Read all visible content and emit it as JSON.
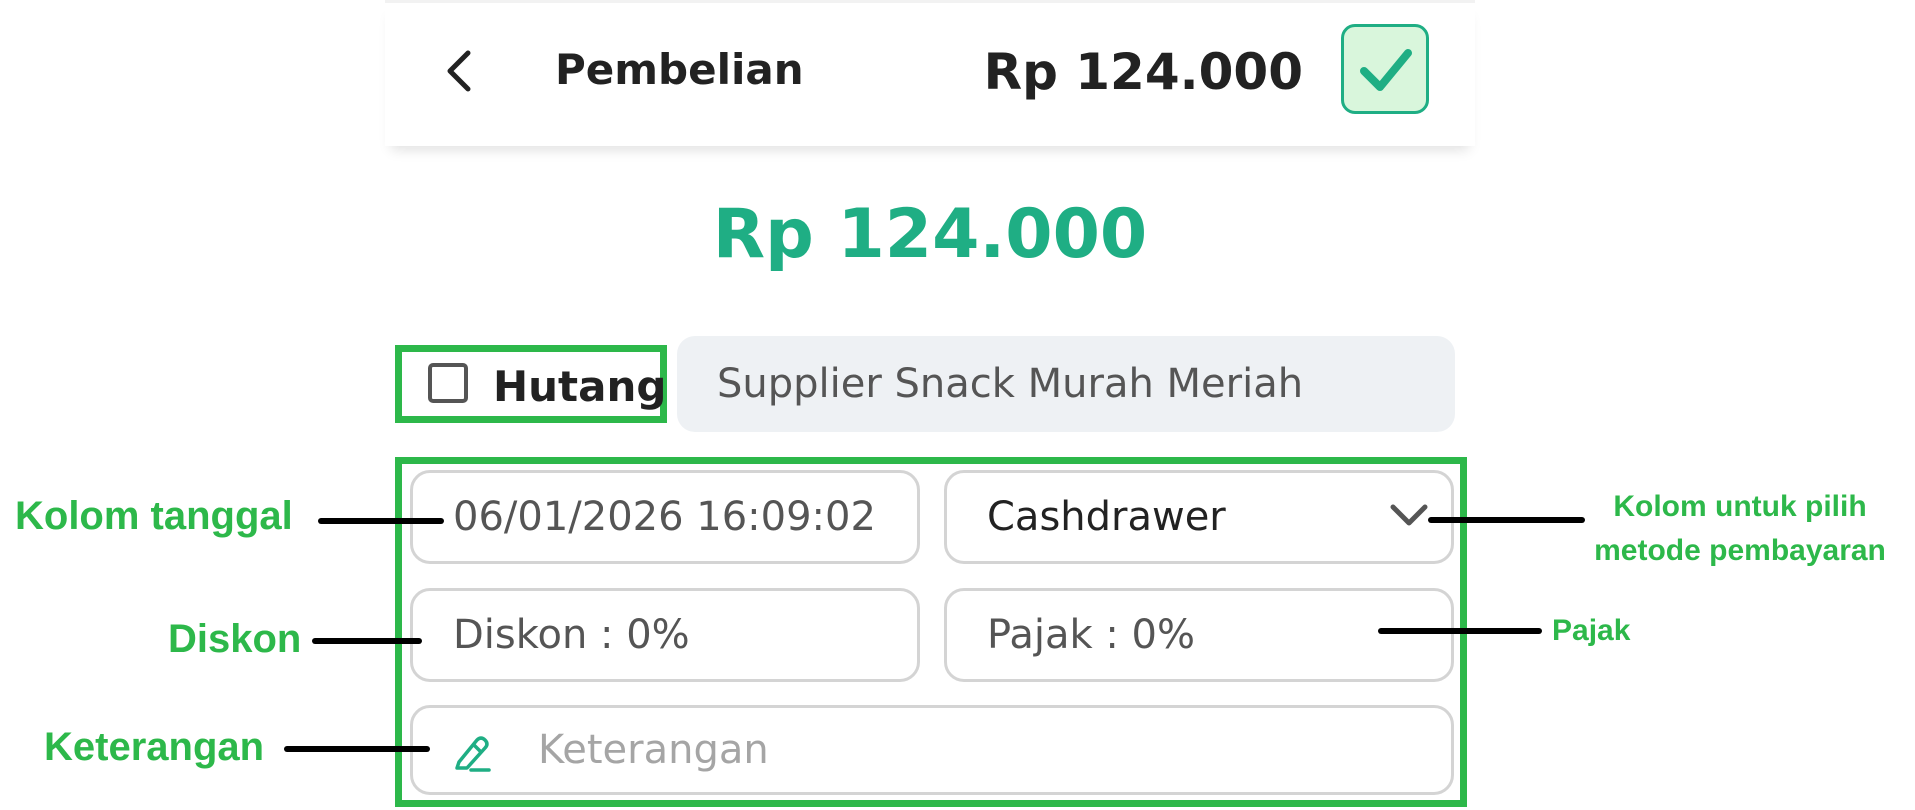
{
  "header": {
    "title": "Pembelian",
    "total": "Rp 124.000",
    "icons": {
      "back": "chevron-left-icon",
      "confirm": "check-icon"
    }
  },
  "summary": {
    "total": "Rp 124.000"
  },
  "hutang": {
    "label": "Hutang",
    "checked": false
  },
  "supplier": {
    "value": "Supplier Snack Murah Meriah"
  },
  "form": {
    "date": "06/01/2026 16:09:02",
    "payment_method": "Cashdrawer",
    "discount": "Diskon : 0%",
    "tax": "Pajak : 0%",
    "note_placeholder": "Keterangan"
  },
  "annotations": {
    "date": "Kolom tanggal",
    "discount": "Diskon",
    "note": "Keterangan",
    "payment_line1": "Kolom untuk pilih",
    "payment_line2": "metode pembayaran",
    "tax": "Pajak"
  },
  "colors": {
    "accent": "#1fae84",
    "annotation": "#2db84a",
    "confirm_bg": "#d9f6dc"
  }
}
